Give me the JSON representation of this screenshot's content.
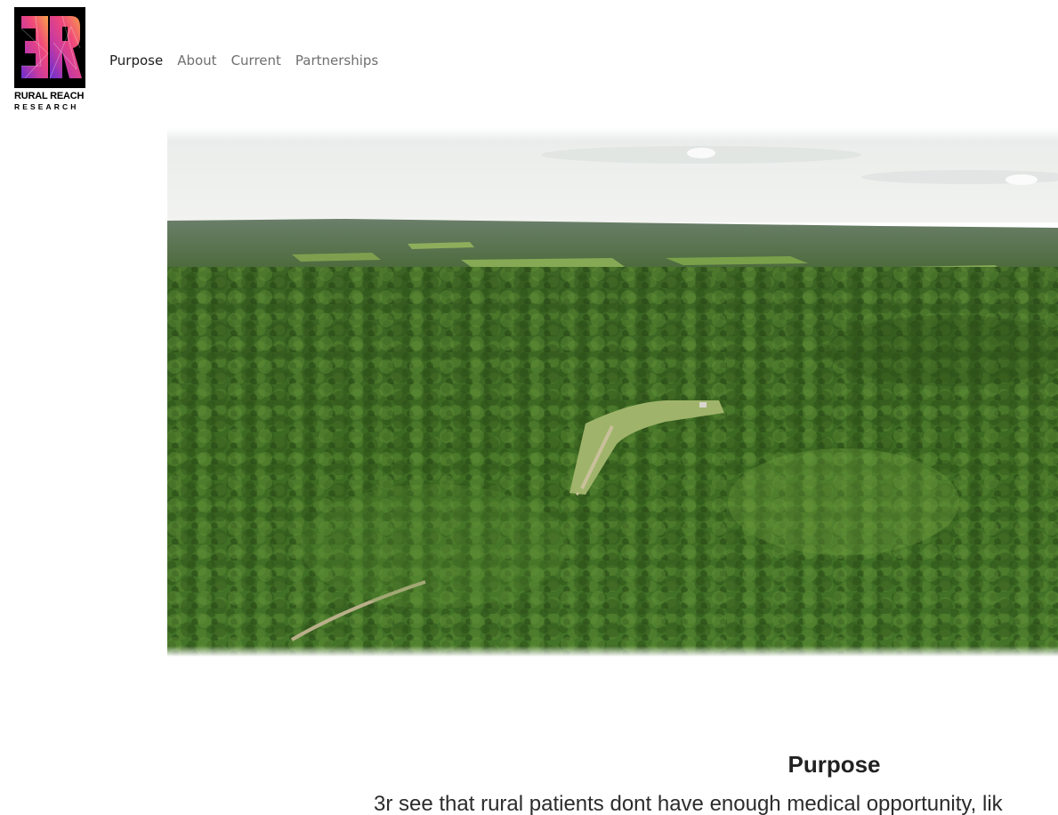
{
  "logo": {
    "monogram": "3R",
    "line1": "RURAL REACH",
    "line2": "RESEARCH"
  },
  "nav": {
    "items": [
      {
        "label": "Purpose",
        "active": true
      },
      {
        "label": "About",
        "active": false
      },
      {
        "label": "Current",
        "active": false
      },
      {
        "label": "Partnerships",
        "active": false
      }
    ]
  },
  "hero": {
    "icon": "aerial-forest-landscape-image"
  },
  "purpose": {
    "title": "Purpose",
    "body": "3r see that rural patients dont have enough medical opportunity, lik"
  },
  "colors": {
    "nav_active": "#1e1e1e",
    "nav_inactive": "#6f6f6f",
    "logo_bg": "#000000",
    "forest_dark": "#2f5a1e",
    "forest_mid": "#4a7a2b",
    "sky": "#eef0ef"
  }
}
